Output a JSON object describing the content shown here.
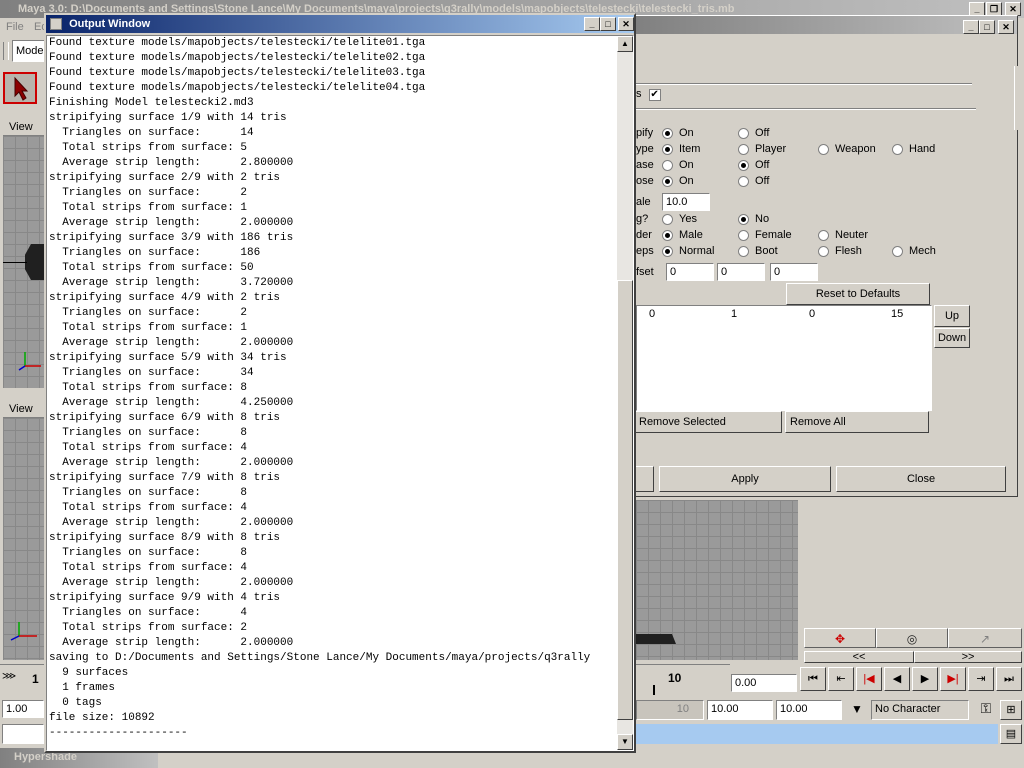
{
  "maya": {
    "title": "Maya 3.0: D:\\Documents and Settings\\Stone Lance\\My Documents\\maya\\projects\\q3rally\\models\\mapobjects\\telestecki\\telestecki_tris.mb",
    "menu": [
      "File",
      "Ed"
    ],
    "mode_dropdown": "Mode",
    "viewport_top_label": "View",
    "viewport_bottom_label": "View",
    "hypershade_label": "Hypershade",
    "frame_field": "1.00",
    "frame_marker_left": "1",
    "timeline_current": "10",
    "current_time_field": "0.00",
    "range_start_label": "10",
    "range_start": "10.00",
    "range_end": "10.00",
    "character_set": "No Character",
    "scroll_left": "<<",
    "scroll_right": ">>"
  },
  "output_window": {
    "title": "Output Window",
    "lines": [
      "Found texture models/mapobjects/telestecki/telelite01.tga",
      "Found texture models/mapobjects/telestecki/telelite02.tga",
      "Found texture models/mapobjects/telestecki/telelite03.tga",
      "Found texture models/mapobjects/telestecki/telelite04.tga",
      "Finishing Model telestecki2.md3",
      "stripifying surface 1/9 with 14 tris",
      "  Triangles on surface:      14",
      "  Total strips from surface: 5",
      "  Average strip length:      2.800000",
      "stripifying surface 2/9 with 2 tris",
      "  Triangles on surface:      2",
      "  Total strips from surface: 1",
      "  Average strip length:      2.000000",
      "stripifying surface 3/9 with 186 tris",
      "  Triangles on surface:      186",
      "  Total strips from surface: 50",
      "  Average strip length:      3.720000",
      "stripifying surface 4/9 with 2 tris",
      "  Triangles on surface:      2",
      "  Total strips from surface: 1",
      "  Average strip length:      2.000000",
      "stripifying surface 5/9 with 34 tris",
      "  Triangles on surface:      34",
      "  Total strips from surface: 8",
      "  Average strip length:      4.250000",
      "stripifying surface 6/9 with 8 tris",
      "  Triangles on surface:      8",
      "  Total strips from surface: 4",
      "  Average strip length:      2.000000",
      "stripifying surface 7/9 with 8 tris",
      "  Triangles on surface:      8",
      "  Total strips from surface: 4",
      "  Average strip length:      2.000000",
      "stripifying surface 8/9 with 8 tris",
      "  Triangles on surface:      8",
      "  Total strips from surface: 4",
      "  Average strip length:      2.000000",
      "stripifying surface 9/9 with 4 tris",
      "  Triangles on surface:      4",
      "  Total strips from surface: 2",
      "  Average strip length:      2.000000",
      "saving to D:/Documents and Settings/Stone Lance/My Documents/maya/projects/q3rally",
      "  9 surfaces",
      "  1 frames",
      "  0 tags",
      "file size: 10892",
      "---------------------"
    ]
  },
  "options": {
    "checkbox_label_tail": "s",
    "rows": [
      {
        "label": "pify",
        "opts": [
          {
            "t": "On",
            "on": true
          },
          {
            "t": "Off",
            "on": false
          }
        ]
      },
      {
        "label": "ype",
        "opts": [
          {
            "t": "Item",
            "on": true
          },
          {
            "t": "Player",
            "on": false
          },
          {
            "t": "Weapon",
            "on": false
          },
          {
            "t": "Hand",
            "on": false
          }
        ]
      },
      {
        "label": "ase",
        "opts": [
          {
            "t": "On",
            "on": false
          },
          {
            "t": "Off",
            "on": true
          }
        ]
      },
      {
        "label": "ose",
        "opts": [
          {
            "t": "On",
            "on": true
          },
          {
            "t": "Off",
            "on": false
          }
        ]
      },
      {
        "label": "g?",
        "opts": [
          {
            "t": "Yes",
            "on": false
          },
          {
            "t": "No",
            "on": true
          }
        ]
      },
      {
        "label": "der",
        "opts": [
          {
            "t": "Male",
            "on": true
          },
          {
            "t": "Female",
            "on": false
          },
          {
            "t": "Neuter",
            "on": false
          }
        ]
      },
      {
        "label": "eps",
        "opts": [
          {
            "t": "Normal",
            "on": true
          },
          {
            "t": "Boot",
            "on": false
          },
          {
            "t": "Flesh",
            "on": false
          },
          {
            "t": "Mech",
            "on": false
          }
        ]
      }
    ],
    "scale_label": "ale",
    "scale_value": "10.0",
    "offset_label": "fset",
    "offset_values": [
      "0",
      "0",
      "0"
    ],
    "reset_button": "Reset to Defaults",
    "list_row": [
      "0",
      "1",
      "0",
      "15"
    ],
    "up_button": "Up",
    "down_button": "Down",
    "remove_selected": "Remove Selected",
    "remove_all": "Remove All",
    "apply": "Apply",
    "close": "Close"
  }
}
